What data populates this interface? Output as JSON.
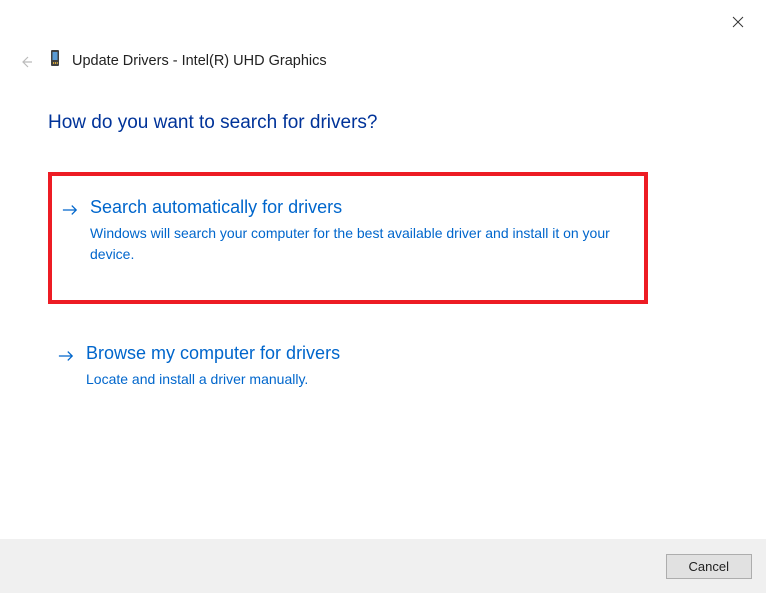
{
  "header": {
    "title": "Update Drivers - Intel(R) UHD Graphics"
  },
  "heading": "How do you want to search for drivers?",
  "options": [
    {
      "title": "Search automatically for drivers",
      "description": "Windows will search your computer for the best available driver and install it on your device."
    },
    {
      "title": "Browse my computer for drivers",
      "description": "Locate and install a driver manually."
    }
  ],
  "footer": {
    "cancel_label": "Cancel"
  }
}
